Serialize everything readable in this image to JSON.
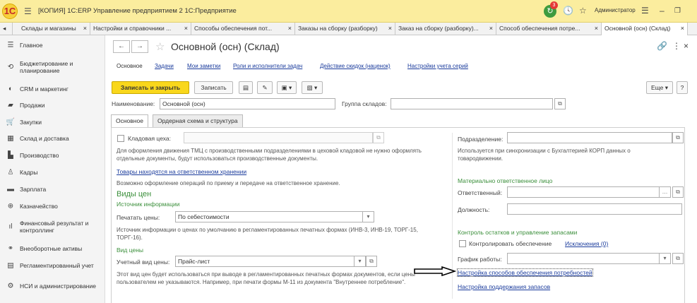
{
  "titlebar": {
    "logo": "1С",
    "title": "[КОПИЯ] 1С:ERP Управление предприятием 2 1С:Предприятие",
    "notifications": "3",
    "user": "Администратор"
  },
  "tabs": [
    {
      "label": "Склады и магазины"
    },
    {
      "label": "Настройки и справочники ..."
    },
    {
      "label": "Способы обеспечения пот..."
    },
    {
      "label": "Заказы на сборку (разборку)"
    },
    {
      "label": "Заказ на сборку (разборку)..."
    },
    {
      "label": "Способ обеспечения потре..."
    },
    {
      "label": "Основной (осн) (Склад)"
    }
  ],
  "sidebar": {
    "items": [
      {
        "label": "Главное",
        "icon": "menu-icon"
      },
      {
        "label": "Бюджетирование и планирование",
        "icon": "budget-icon"
      },
      {
        "label": "CRM и маркетинг",
        "icon": "crm-icon"
      },
      {
        "label": "Продажи",
        "icon": "sales-icon"
      },
      {
        "label": "Закупки",
        "icon": "cart-icon"
      },
      {
        "label": "Склад и доставка",
        "icon": "warehouse-icon"
      },
      {
        "label": "Производство",
        "icon": "factory-icon"
      },
      {
        "label": "Кадры",
        "icon": "person-icon"
      },
      {
        "label": "Зарплата",
        "icon": "salary-icon"
      },
      {
        "label": "Казначейство",
        "icon": "treasury-icon"
      },
      {
        "label": "Финансовый результат и контроллинг",
        "icon": "chart-icon"
      },
      {
        "label": "Внеоборотные активы",
        "icon": "assets-icon"
      },
      {
        "label": "Регламентированный учет",
        "icon": "accounting-icon"
      },
      {
        "label": "НСИ и администрирование",
        "icon": "gear-icon"
      }
    ]
  },
  "form": {
    "title": "Основной (осн) (Склад)",
    "top_links": [
      "Основное",
      "Задачи",
      "Мои заметки",
      "Роли и исполнители задач",
      "Действие скидок (наценок)",
      "Настройки учета серий"
    ],
    "buttons": {
      "save_close": "Записать и закрыть",
      "save": "Записать",
      "more": "Еще",
      "help": "?"
    },
    "name_label": "Наименование:",
    "name_value": "Основной (осн)",
    "group_label": "Группа складов:",
    "group_value": "",
    "form_tabs": [
      "Основное",
      "Ордерная схема и структура"
    ]
  },
  "left": {
    "pantry_label": "Кладовая цеха:",
    "pantry_note": "Для оформления движения ТМЦ с производственными подразделениями в цеховой кладовой не нужно оформлять отдельные документы, будут использоваться производственные документы.",
    "custody_link": "Товары находятся на ответственном хранении",
    "custody_note": "Возможно оформление операций по приему и передаче на ответственное хранение.",
    "price_head": "Виды цен",
    "source_head": "Источник информации",
    "print_label": "Печатать цены:",
    "print_value": "По себестоимости",
    "source_note": "Источник информации о ценах по умолчанию в регламентированных печатных формах (ИНВ-3, ИНВ-19, ТОРГ-15, ТОРГ-16).",
    "pricetype_head": "Вид цены",
    "account_label": "Учетный вид цены:",
    "account_value": "Прайс-лист",
    "account_note": "Этот вид цен будет использоваться при выводе в регламентированных печатных формах документов, если цены пользователем не указываются. Например, при печати формы М-11 из документа \"Внутреннее потребление\"."
  },
  "right": {
    "division_label": "Подразделение:",
    "division_value": "",
    "division_note": "Используется при синхронизации с Бухгалтерией КОРП данных о товародвижении.",
    "mol_head": "Материально ответственное лицо",
    "responsible_label": "Ответственный:",
    "responsible_value": "",
    "position_label": "Должность:",
    "position_value": "",
    "control_head": "Контроль остатков и управление запасами",
    "control_check": "Контролировать обеспечение",
    "exceptions_link": "Исключения (0)",
    "schedule_label": "График работы:",
    "schedule_value": "",
    "methods_link": "Настройка способов обеспечения потребностей",
    "stock_link": "Настройка поддержания запасов"
  }
}
